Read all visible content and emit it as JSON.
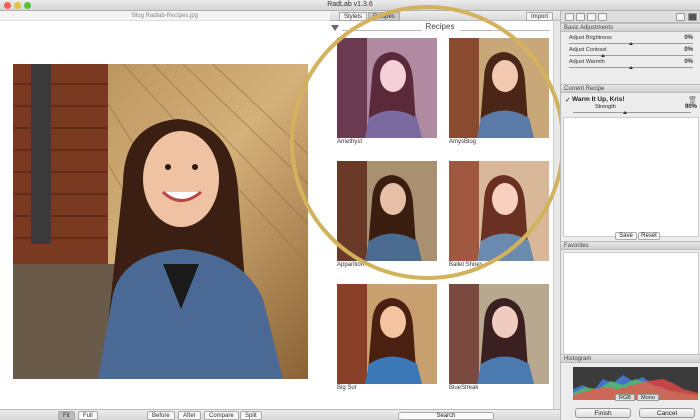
{
  "window": {
    "title": "RadLab v1.3.6"
  },
  "document": {
    "filename": "Blog Radlab-Recipes.jpg"
  },
  "tabs": {
    "styles": "Stylets",
    "recipes": "Recipes",
    "import": "Import"
  },
  "recipes": {
    "header": "Recipes",
    "items": [
      {
        "name": "Amethyst"
      },
      {
        "name": "AmysBlog"
      },
      {
        "name": "Apparition"
      },
      {
        "name": "Ballet Shoes"
      },
      {
        "name": "Big Sur"
      },
      {
        "name": "BlueStreak"
      }
    ],
    "search_label": "Search"
  },
  "bottom_bar": {
    "fit": "Fit",
    "full": "Full",
    "before": "Before",
    "after": "After",
    "compare": "Compare",
    "split": "Split"
  },
  "side_panel": {
    "basic_adjustments": {
      "title": "Basic Adjustments",
      "sliders": [
        {
          "label": "Adjust Brightness",
          "value": "0%"
        },
        {
          "label": "Adjust Contrast",
          "value": "0%"
        },
        {
          "label": "Adjust Warmth",
          "value": "0%"
        }
      ]
    },
    "current_recipe": {
      "title": "Current Recipe",
      "item_name": "Warm It Up, Kris!",
      "strength_label": "Strength",
      "strength_value": "90%",
      "save_label": "Save",
      "reset_label": "Reset"
    },
    "favorites": {
      "title": "Favorites"
    },
    "histogram": {
      "title": "Histogram",
      "rgb_label": "RGB",
      "mono_label": "Mono"
    },
    "finish_label": "Finish",
    "cancel_label": "Cancel"
  },
  "colors": {
    "highlight_circle": "#d2b25c"
  }
}
